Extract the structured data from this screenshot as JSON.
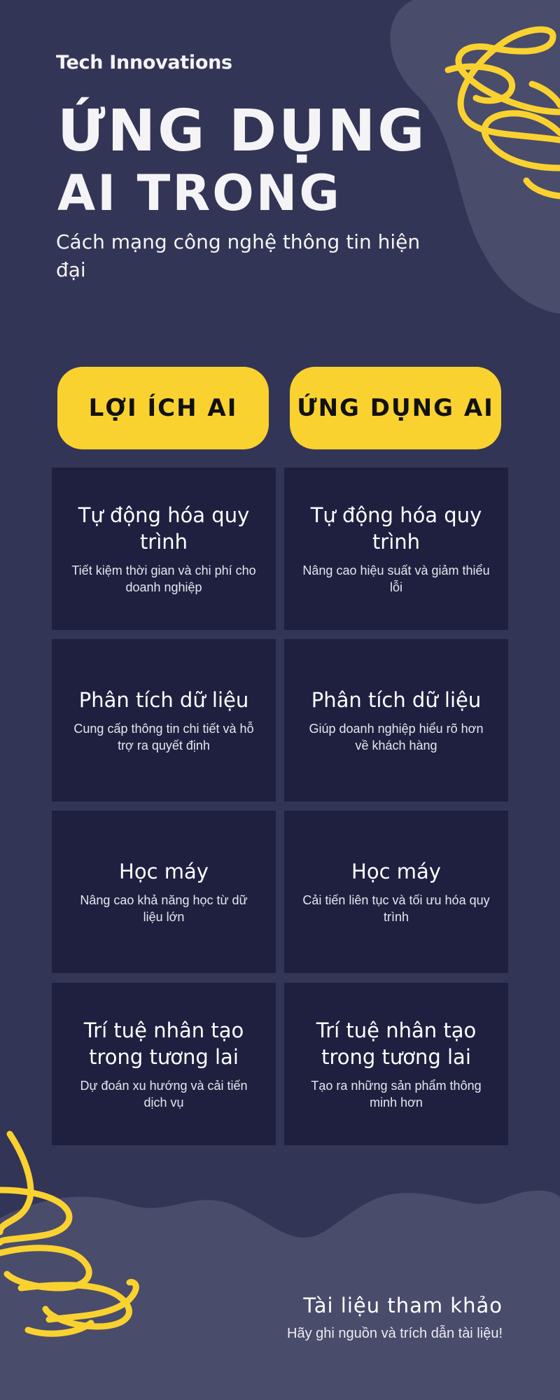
{
  "header": {
    "brand": "Tech Innovations",
    "title_line1": "ỨNG DỤNG",
    "title_line2": "AI TRONG",
    "subtitle": "Cách mạng công nghệ thông tin hiện đại"
  },
  "columns": {
    "left_heading": "LỢI ÍCH AI",
    "right_heading": "ỨNG DỤNG AI"
  },
  "cards": [
    {
      "left": {
        "title": "Tự động hóa quy trình",
        "desc": "Tiết kiệm thời gian và chi phí cho doanh nghiệp"
      },
      "right": {
        "title": "Tự động hóa quy trình",
        "desc": "Nâng cao hiệu suất và giảm thiểu lỗi"
      }
    },
    {
      "left": {
        "title": "Phân tích dữ liệu",
        "desc": "Cung cấp thông tin chi tiết và hỗ trợ ra quyết định"
      },
      "right": {
        "title": "Phân tích dữ liệu",
        "desc": "Giúp doanh nghiệp hiểu rõ hơn về khách hàng"
      }
    },
    {
      "left": {
        "title": "Học máy",
        "desc": "Nâng cao khả năng học từ dữ liệu lớn"
      },
      "right": {
        "title": "Học máy",
        "desc": "Cải tiến liên tục và tối ưu hóa quy trình"
      }
    },
    {
      "left": {
        "title": "Trí tuệ nhân tạo trong tương lai",
        "desc": "Dự đoán xu hướng và cải tiến dịch vụ"
      },
      "right": {
        "title": "Trí tuệ nhân tạo trong tương lai",
        "desc": "Tạo ra những sản phẩm thông minh hơn"
      }
    }
  ],
  "footer": {
    "ref_title": "Tài liệu tham khảo",
    "ref_note": "Hãy ghi nguồn và trích dẫn tài liệu!"
  },
  "colors": {
    "background": "#333556",
    "blob": "#4a4c6c",
    "accent_yellow": "#fad230",
    "card": "#1f2040",
    "text": "#ffffff"
  },
  "icons": [
    "squiggle-decoration-top-right",
    "squiggle-decoration-bottom-left"
  ]
}
